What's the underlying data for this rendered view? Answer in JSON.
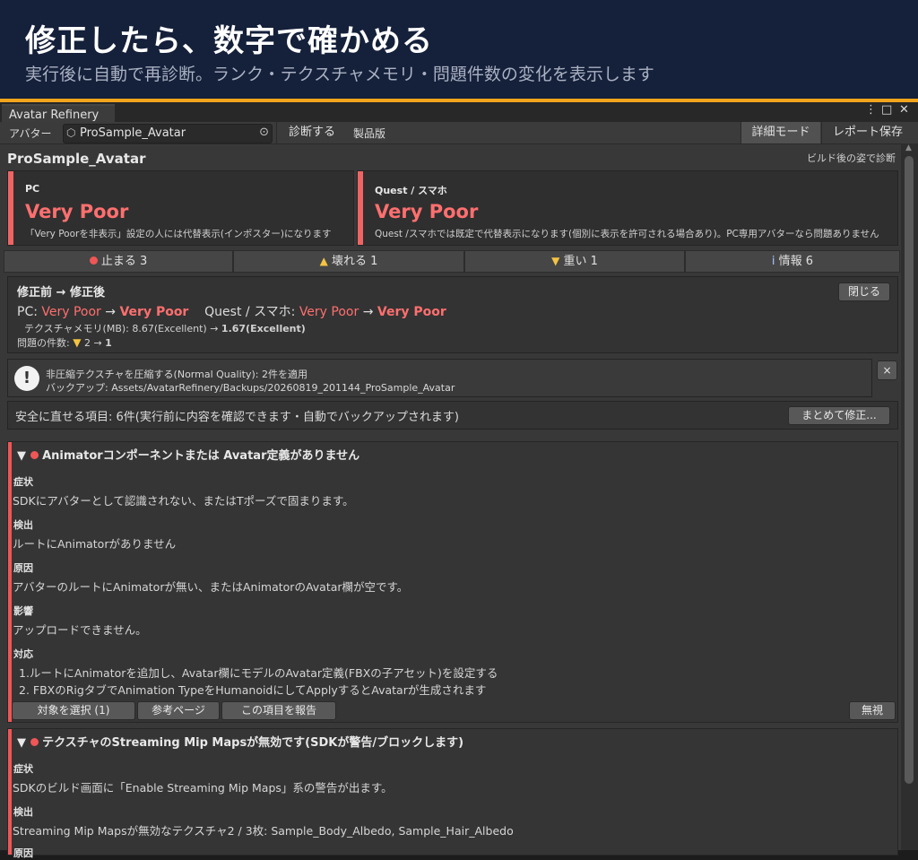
{
  "banner": {
    "title": "修正したら、数字で確かめる",
    "subtitle": "実行後に自動で再診断。ランク・テクスチャメモリ・問題件数の変化を表示します"
  },
  "window": {
    "tab_title": "Avatar Refinery",
    "icons": [
      "kebab-menu-icon",
      "maximize-icon",
      "close-icon"
    ],
    "kebab": "⋮",
    "maximize": "□",
    "close": "✕"
  },
  "toolbar": {
    "avatar_label": "アバター",
    "avatar_value": "ProSample_Avatar",
    "diagnose_button": "診断する",
    "edition": "製品版",
    "detail_mode": "詳細モード",
    "save_report": "レポート保存"
  },
  "header": {
    "avatar_name": "ProSample_Avatar",
    "build_view": "ビルド後の姿で診断"
  },
  "ratings": [
    {
      "label": "PC",
      "rating": "Very Poor",
      "note": "「Very Poorを非表示」設定の人には代替表示(インポスター)になります"
    },
    {
      "label": "Quest / スマホ",
      "rating": "Very Poor",
      "note": "Quest /スマホでは既定で代替表示になります(個別に表示を許可される場合あり)。PC専用アバターなら問題ありません"
    }
  ],
  "counts": {
    "stop": "止まる 3",
    "break": "壊れる 1",
    "heavy": "重い 1",
    "info": "情報 6"
  },
  "comparison": {
    "title": "修正前 → 修正後",
    "close_button": "閉じる",
    "pc_label": "PC:",
    "pc_before": "Very Poor",
    "pc_after": "Very Poor",
    "quest_label": "Quest / スマホ:",
    "quest_before": "Very Poor",
    "quest_after": "Very Poor",
    "arrow": "→",
    "tex_mem_prefix": "テクスチャメモリ(MB): 8.67(Excellent) →",
    "tex_mem_after": "1.67(Excellent)",
    "issue_count_label": "問題の件数:",
    "issue_count_before": "2",
    "issue_count_after": "1"
  },
  "applied": {
    "line1": "非圧縮テクスチャを圧縮する(Normal Quality): 2件を適用",
    "line2": "バックアップ: Assets/AvatarRefinery/Backups/20260819_201144_ProSample_Avatar",
    "dismiss": "×"
  },
  "safe_fix": {
    "text": "安全に直せる項目: 6件(実行前に内容を確認できます・自動でバックアップされます)",
    "button": "まとめて修正..."
  },
  "issues": [
    {
      "title": "Animatorコンポーネントまたは Avatar定義がありません",
      "h_symptom": "症状",
      "symptom": "SDKにアバターとして認識されない、またはTポーズで固まります。",
      "h_detect": "検出",
      "detect": "ルートにAnimatorがありません",
      "h_cause": "原因",
      "cause": "アバターのルートにAnimatorが無い、またはAnimatorのAvatar欄が空です。",
      "h_impact": "影響",
      "impact": "アップロードできません。",
      "h_fix": "対応",
      "fix1": "1.ルートにAnimatorを追加し、Avatar欄にモデルのAvatar定義(FBXの子アセット)を設定する",
      "fix2": "2. FBXのRigタブでAnimation TypeをHumanoidにしてApplyするとAvatarが生成されます",
      "btn_select": "対象を選択 (1)",
      "btn_ref": "参考ページ",
      "btn_report": "この項目を報告",
      "btn_ignore": "無視"
    },
    {
      "title": "テクスチャのStreaming Mip Mapsが無効です(SDKが警告/ブロックします)",
      "h_symptom": "症状",
      "symptom": "SDKのビルド画面に「Enable Streaming Mip Maps」系の警告が出ます。",
      "h_detect": "検出",
      "detect": "Streaming Mip Mapsが無効なテクスチャ2 / 3枚: Sample_Body_Albedo, Sample_Hair_Albedo",
      "h_cause": "原因"
    }
  ],
  "colors": {
    "accent": "#f2a51c",
    "very_poor": "#ff6f6f",
    "error_dot": "#ef5656",
    "warning": "#f4c342",
    "banner_bg": "#15203a"
  }
}
